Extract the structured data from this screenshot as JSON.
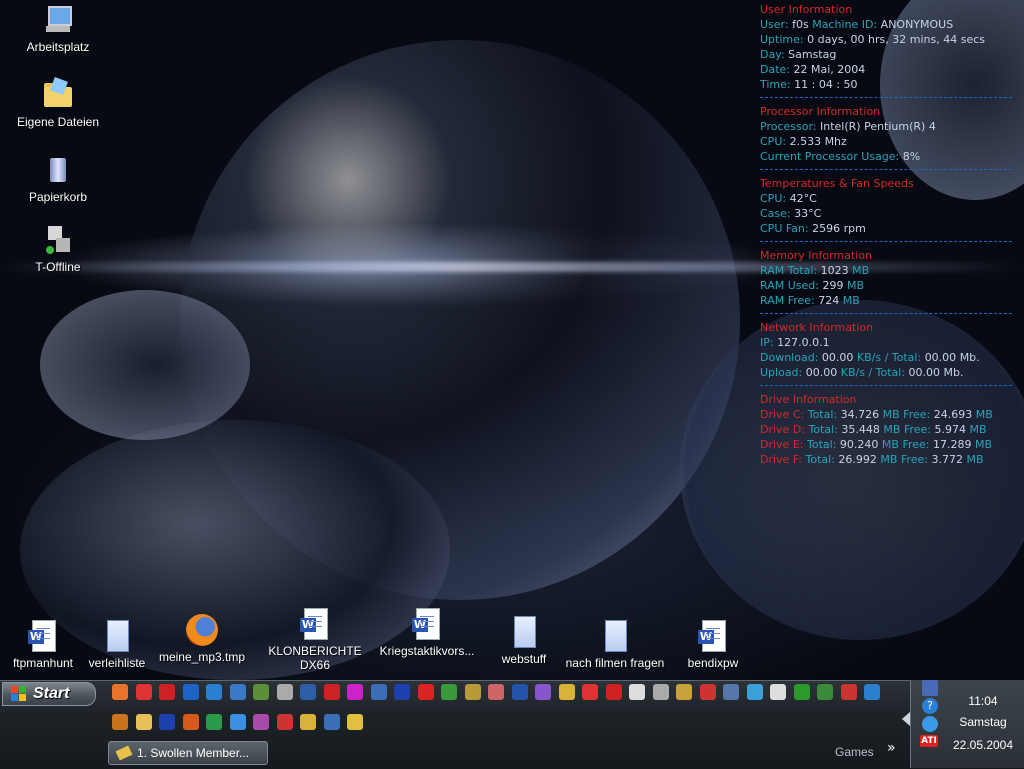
{
  "desktop_icons_top": [
    {
      "label": "Arbeitsplatz"
    },
    {
      "label": "Eigene Dateien"
    },
    {
      "label": "Papierkorb"
    },
    {
      "label": "T-Offline"
    }
  ],
  "desktop_icons_bottom": [
    {
      "label": "ftpmanhunt",
      "icon": "word-document-icon"
    },
    {
      "label": "verleihliste",
      "icon": "text-document-icon"
    },
    {
      "label": "meine_mp3.tmp",
      "icon": "firefox-icon"
    },
    {
      "label": "KLONBERICHTE DX66",
      "icon": "word-document-icon"
    },
    {
      "label": "Kriegstaktikvors...",
      "icon": "word-document-icon"
    },
    {
      "label": "webstuff",
      "icon": "text-document-icon"
    },
    {
      "label": "nach filmen fragen",
      "icon": "text-document-icon"
    },
    {
      "label": "bendixpw",
      "icon": "word-document-icon"
    }
  ],
  "monitor": {
    "user": {
      "title": "User Information",
      "user_key": "User:",
      "user_val": "f0s",
      "machine_key": "Machine ID:",
      "machine_val": "ANONYMOUS",
      "uptime_key": "Uptime:",
      "uptime_val": "0 days, 00 hrs, 32 mins, 44 secs",
      "day_key": "Day:",
      "day_val": "Samstag",
      "date_key": "Date:",
      "date_val": "22 Mai, 2004",
      "time_key": "Time:",
      "time_val": "11 : 04 : 50"
    },
    "processor": {
      "title": "Processor Information",
      "proc_key": "Processor:",
      "proc_val": "Intel(R) Pentium(R) 4",
      "cpu_key": "CPU:",
      "cpu_val": "2.533 Mhz",
      "usage_key": "Current Processor Usage:",
      "usage_val": "8%"
    },
    "temps": {
      "title": "Temperatures & Fan Speeds",
      "cpu_key": "CPU:",
      "cpu_val": "42°C",
      "case_key": "Case:",
      "case_val": "33°C",
      "fan_key": "CPU Fan:",
      "fan_val": "2596 rpm"
    },
    "memory": {
      "title": "Memory Information",
      "total_key": "RAM Total:",
      "total_val": "1023",
      "total_unit": "MB",
      "used_key": "RAM Used:",
      "used_val": "299",
      "used_unit": "MB",
      "free_key": "RAM Free:",
      "free_val": "724",
      "free_unit": "MB"
    },
    "network": {
      "title": "Network Information",
      "ip_key": "IP:",
      "ip_val": "127.0.0.1",
      "down_key": "Download:",
      "down_val": "00.00",
      "down_rest": "KB/s / Total:",
      "down_total": "00.00",
      "down_unit": "Mb.",
      "up_key": "Upload:",
      "up_val": "00.00",
      "up_rest": "KB/s / Total:",
      "up_total": "00.00",
      "up_unit": "Mb."
    },
    "drives": {
      "title": "Drive Information",
      "rows": [
        {
          "name": "Drive C:",
          "total_key": "Total:",
          "total": "34.726",
          "total_unit": "MB",
          "free_key": "Free:",
          "free": "24.693",
          "free_unit": "MB"
        },
        {
          "name": "Drive D:",
          "total_key": "Total:",
          "total": "35.448",
          "total_unit": "MB",
          "free_key": "Free:",
          "free": "5.974",
          "free_unit": "MB"
        },
        {
          "name": "Drive E:",
          "total_key": "Total:",
          "total": "90.240",
          "total_unit": "MB",
          "free_key": "Free:",
          "free": "17.289",
          "free_unit": "MB"
        },
        {
          "name": "Drive F:",
          "total_key": "Total:",
          "total": "26.992",
          "total_unit": "MB",
          "free_key": "Free:",
          "free": "3.772",
          "free_unit": "MB"
        }
      ]
    }
  },
  "taskbar": {
    "start_label": "Start",
    "task_button_label": "1. Swollen Member...",
    "toolbar_label": "Games",
    "toolbar_chevron": "»",
    "clock_time": "11:04",
    "clock_day": "Samstag",
    "clock_date": "22.05.2004",
    "quicklaunch_row1_colors": [
      "#e8742a",
      "#d33",
      "#c22",
      "#1e63c8",
      "#2a7fd0",
      "#3a79c8",
      "#5b8f3a",
      "#aaa",
      "#2d5fa8",
      "#c22",
      "#c2c",
      "#3a6fb8",
      "#1e3fae",
      "#d22",
      "#3a9a3a",
      "#b89a3a",
      "#c66",
      "#2255aa",
      "#8855cc",
      "#d9b23a",
      "#d33",
      "#c22",
      "#ddd",
      "#aaa",
      "#c9a23a",
      "#c33",
      "#5577aa",
      "#3aa0d8",
      "#ddd",
      "#2a9a2a",
      "#3a8a3a",
      "#c33",
      "#2a7fd0"
    ],
    "quicklaunch_row2_colors": [
      "#c9741a",
      "#e8c05a",
      "#1e3fae",
      "#d85a1a",
      "#2a9a4a",
      "#3a8fe0",
      "#a84aa8",
      "#c33",
      "#d9b23a",
      "#3a6fb8",
      "#e0c040"
    ]
  }
}
